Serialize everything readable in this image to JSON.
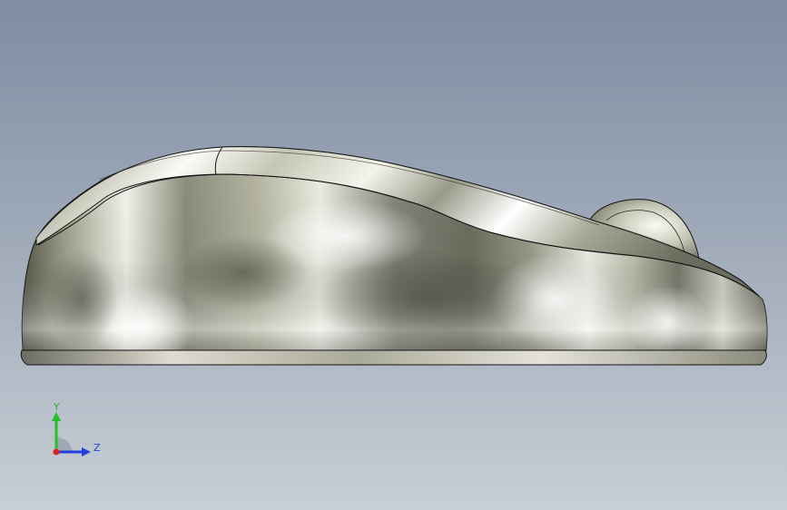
{
  "viewport": {
    "background_top": "#7f8da2",
    "background_bottom": "#c8ced6"
  },
  "model": {
    "material_light": "#ffffff",
    "material_mid": "#b7b7a6",
    "material_dark": "#4e4e42",
    "edge_color": "#141414"
  },
  "triad": {
    "y_label": "Y",
    "z_label": "Z",
    "y_color": "#22c02a",
    "z_color": "#2040e0",
    "x_color": "#e02020"
  }
}
